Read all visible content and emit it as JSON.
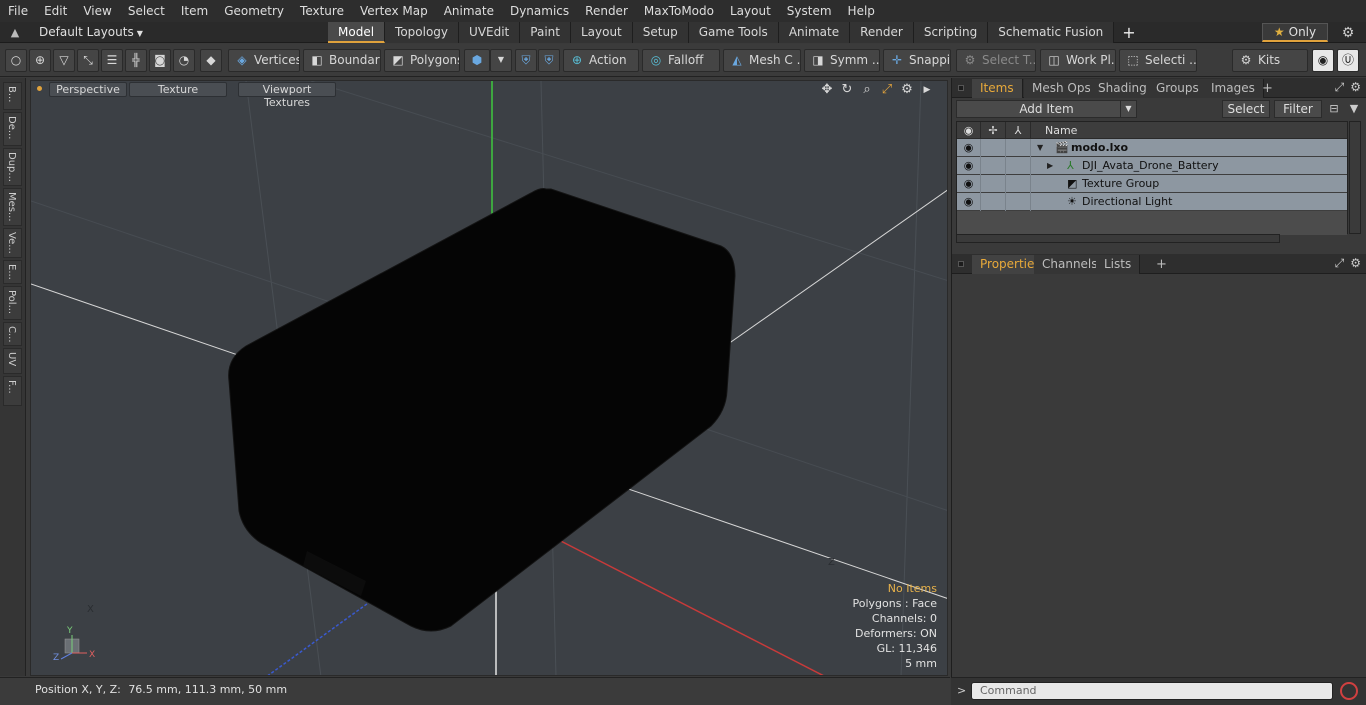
{
  "menu": [
    "File",
    "Edit",
    "View",
    "Select",
    "Item",
    "Geometry",
    "Texture",
    "Vertex Map",
    "Animate",
    "Dynamics",
    "Render",
    "MaxToModo",
    "Layout",
    "System",
    "Help"
  ],
  "layout_bar": {
    "layouts_label": "Default Layouts",
    "tabs": [
      "Model",
      "Topology",
      "UVEdit",
      "Paint",
      "Layout",
      "Setup",
      "Game Tools",
      "Animate",
      "Render",
      "Scripting",
      "Schematic Fusion"
    ],
    "active_tab": "Model",
    "plus": "+",
    "only_label": "Only"
  },
  "toolbar": {
    "vertices": "Vertices",
    "boundary": "Boundary",
    "polygons": "Polygons",
    "action": "Action",
    "falloff": "Falloff",
    "mesh": "Mesh C ...",
    "symm": "Symm ...",
    "snapping": "Snapping",
    "select_t": "Select T...",
    "work_pl": "Work Pl...",
    "selecti": "Selecti ...",
    "kits": "Kits"
  },
  "left_tabs": [
    "B...",
    "De...",
    "Dup...",
    "Mes...",
    "Ve...",
    "E...",
    "Pol...",
    "C...",
    "UV",
    "F..."
  ],
  "viewport": {
    "perspective": "Perspective",
    "texture": "Texture",
    "viewport_textures": "Viewport Textures",
    "axis_y": "Y",
    "axis_z": "Z",
    "axis_x": "X",
    "info": {
      "no_items": "No Items",
      "polygons": "Polygons : Face",
      "channels": "Channels: 0",
      "deformers": "Deformers: ON",
      "gl": "GL: 11,346",
      "scale": "5 mm"
    }
  },
  "status": {
    "position_label": "Position X, Y, Z:",
    "position_value": "76.5 mm, 111.3 mm, 50 mm"
  },
  "items_panel": {
    "tabs": [
      "Items",
      "Mesh Ops",
      "Shading",
      "Groups",
      "Images"
    ],
    "active_tab": "Items",
    "plus": "+",
    "add_item": "Add Item",
    "select": "Select",
    "filter": "Filter",
    "name_col": "Name",
    "rows": [
      {
        "label": "modo.lxo"
      },
      {
        "label": "DJI_Avata_Drone_Battery"
      },
      {
        "label": "Texture Group"
      },
      {
        "label": "Directional Light"
      }
    ]
  },
  "props_panel": {
    "tabs": [
      "Properties",
      "Channels",
      "Lists"
    ],
    "active_tab": "Properties",
    "plus": "+"
  },
  "command": {
    "prompt": ">",
    "placeholder": "Command"
  },
  "colors": {
    "accent": "#e0a23c",
    "row_bg": "#8d97a1",
    "viewport_bg": "#3c4045"
  }
}
